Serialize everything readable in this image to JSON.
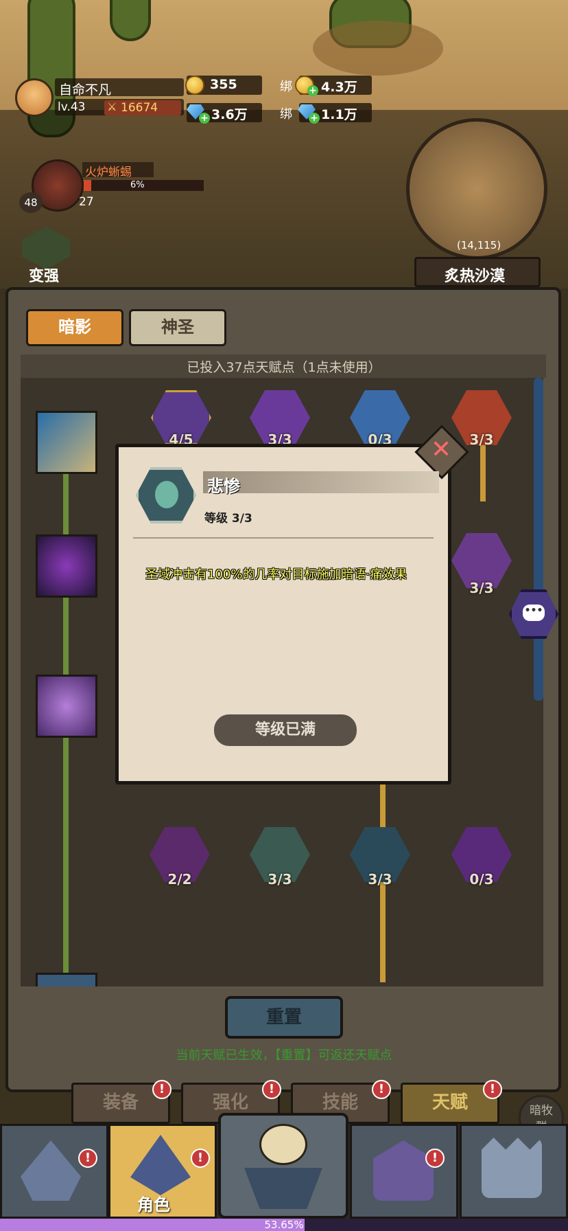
{
  "player": {
    "name": "自命不凡",
    "level": "lv.43",
    "power": "16674"
  },
  "resources": {
    "gold": "355",
    "bound_label": "绑",
    "bound_gold": "4.3万",
    "diamond": "3.6万",
    "bound_diamond": "1.1万"
  },
  "mob": {
    "name": "火炉蜥蜴",
    "hp_percent_text": "6%",
    "hp_fraction": 0.06,
    "level": "48",
    "count": "27"
  },
  "strengthen_label": "变强",
  "map": {
    "coords": "(14,115)",
    "zone": "炙热沙漠"
  },
  "tabs": [
    "暗影",
    "神圣"
  ],
  "talent_points_text": "已投入37点天赋点（1点未使用）",
  "tree_nodes_top": [
    "4/5",
    "3/3",
    "0/3",
    "3/3"
  ],
  "tree_nodes_right": [
    "3/3"
  ],
  "tree_nodes_bottom": [
    "2/2",
    "3/3",
    "3/3",
    "0/3"
  ],
  "popup": {
    "title": "悲惨",
    "level": "等级 3/3",
    "description": "圣域冲击有100%的几率对目标施加暗语·痛效果",
    "button": "等级已满"
  },
  "reset": {
    "button": "重置",
    "hint": "当前天赋已生效，【重置】可返还天赋点"
  },
  "subtabs": [
    "装备",
    "强化",
    "技能",
    "天赋"
  ],
  "badge": "!",
  "group_button": [
    "暗牧",
    "群"
  ],
  "bottom_nav": {
    "role_label": "角色"
  },
  "exp": {
    "text": "53.65%",
    "fraction": 0.5365
  },
  "colors": {
    "accent_orange": "#d78c35",
    "desc_yellow": "#ffff66",
    "hint_green": "#3a9a2e",
    "exp_purple": "#b77de0"
  }
}
